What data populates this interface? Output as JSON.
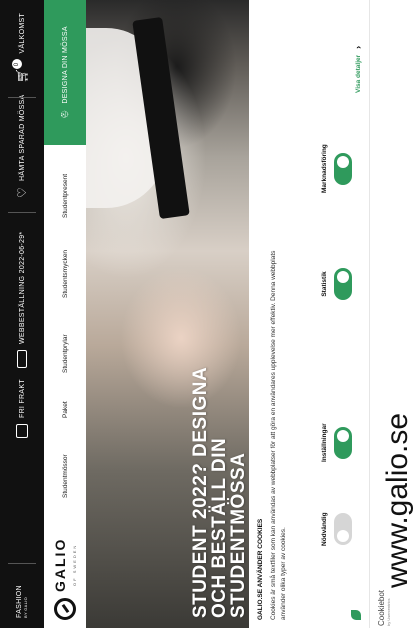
{
  "topbar": {
    "fashion": "FASHION",
    "fashion_sub": "BY GALIO",
    "free_shipping": "FRI FRAKT",
    "web_order": "WEBBESTÄLLNING 2022-06-29*",
    "pickup": "HÄMTA SPARAD MÖSSA",
    "login": "VÄLKOMST",
    "cart_count": "0"
  },
  "logo": {
    "name": "GALIO",
    "tagline": "OF SWEDEN"
  },
  "nav": [
    "Studentmössor",
    "Paket",
    "Studentprylar",
    "Studentsmycken",
    "Studentpresent"
  ],
  "cta": {
    "label": "DESIGNA DIN MÖSSA"
  },
  "hero": {
    "title_lines": [
      "STUDENT 2022? DESIGNA",
      "OCH BESTÄLL DIN",
      "STUDENTMÖSSA"
    ]
  },
  "cookie": {
    "title": "GALIO.SE ANVÄNDER COOKIES",
    "body": "Cookies är små textfiler som kan användas av webbplatser för att göra en användares upplevelse mer effektiv. Denna webbplats använder olika typer av cookies.",
    "toggles": [
      {
        "label": "Nödvändig",
        "state": "off"
      },
      {
        "label": "Inställningar",
        "state": "on"
      },
      {
        "label": "Statistik",
        "state": "on"
      },
      {
        "label": "Marknadsföring",
        "state": "on"
      }
    ],
    "details_label": "Visa detaljer",
    "brand": "Cookiebot",
    "brand_sub": "by Usercentrics"
  },
  "url": "www.galio.se",
  "colors": {
    "accent": "#2f9a5c",
    "topbar": "#111111"
  }
}
